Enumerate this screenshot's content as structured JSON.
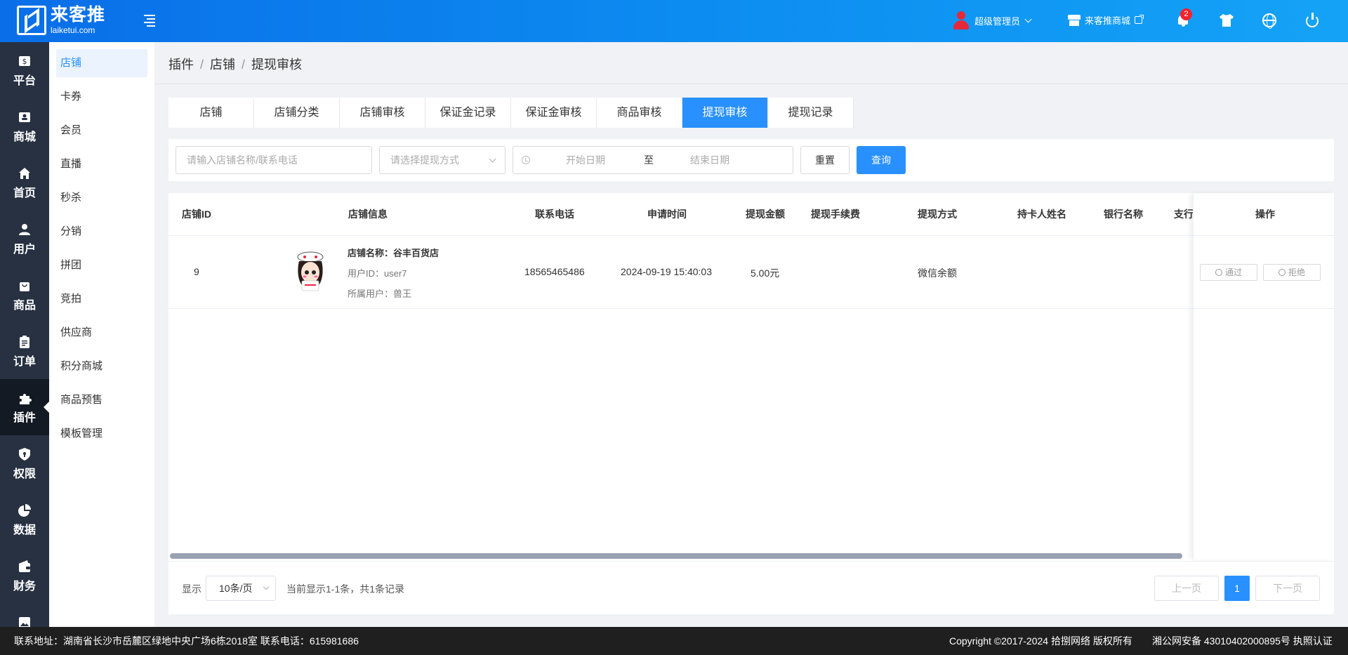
{
  "header": {
    "logo_cn": "来客推",
    "logo_en": "laiketui.com",
    "admin_label": "超级管理员",
    "store_label": "来客推商城",
    "notification_count": "2"
  },
  "sidebar": {
    "items": [
      {
        "label": "平台",
        "icon": "dollar-icon"
      },
      {
        "label": "商城",
        "icon": "store-icon"
      },
      {
        "label": "首页",
        "icon": "home-icon"
      },
      {
        "label": "用户",
        "icon": "user-icon"
      },
      {
        "label": "商品",
        "icon": "bag-icon"
      },
      {
        "label": "订单",
        "icon": "clipboard-icon"
      },
      {
        "label": "插件",
        "icon": "puzzle-icon",
        "active": true
      },
      {
        "label": "权限",
        "icon": "shield-icon"
      },
      {
        "label": "数据",
        "icon": "pie-chart-icon"
      },
      {
        "label": "财务",
        "icon": "wallet-icon"
      }
    ]
  },
  "submenu": {
    "items": [
      "店铺",
      "卡券",
      "会员",
      "直播",
      "秒杀",
      "分销",
      "拼团",
      "竞拍",
      "供应商",
      "积分商城",
      "商品预售",
      "模板管理"
    ]
  },
  "breadcrumb": [
    "插件",
    "店铺",
    "提现审核"
  ],
  "tabs": [
    "店铺",
    "店铺分类",
    "店铺审核",
    "保证金记录",
    "保证金审核",
    "商品审核",
    "提现审核",
    "提现记录"
  ],
  "filter": {
    "search_placeholder": "请输入店铺名称/联系电话",
    "method_placeholder": "请选择提现方式",
    "start_placeholder": "开始日期",
    "range_sep": "至",
    "end_placeholder": "结束日期",
    "reset_label": "重置",
    "query_label": "查询"
  },
  "table": {
    "columns": [
      "店铺ID",
      "店铺信息",
      "联系电话",
      "申请时间",
      "提现金额",
      "提现手续费",
      "提现方式",
      "持卡人姓名",
      "银行名称",
      "支行",
      "操作"
    ],
    "rows": [
      {
        "id": "9",
        "store_name": "店铺名称：谷丰百货店",
        "user_id": "用户ID：user7",
        "owner": "所属用户：兽王",
        "phone": "18565465486",
        "apply_time": "2024-09-19 15:40:03",
        "amount": "5.00元",
        "fee": "",
        "method": "微信余额",
        "holder": "",
        "bank": "",
        "branch": "",
        "approve_label": "通过",
        "reject_label": "拒绝"
      }
    ]
  },
  "pagination": {
    "show_label": "显示",
    "page_size": "10条/页",
    "summary": "当前显示1-1条，共1条记录",
    "prev_label": "上一页",
    "current_page": "1",
    "next_label": "下一页"
  },
  "footer": {
    "address": "联系地址：湖南省长沙市岳麓区绿地中央广场6栋2018室 联系电话：615981686",
    "copyright": "Copyright ©2017-2024 拾捌网络 版权所有",
    "icp": "湘公网安备 43010402000895号 执照认证"
  },
  "colors": {
    "primary": "#2890ff",
    "sidebar_bg": "#273142",
    "badge": "#f5222d"
  }
}
